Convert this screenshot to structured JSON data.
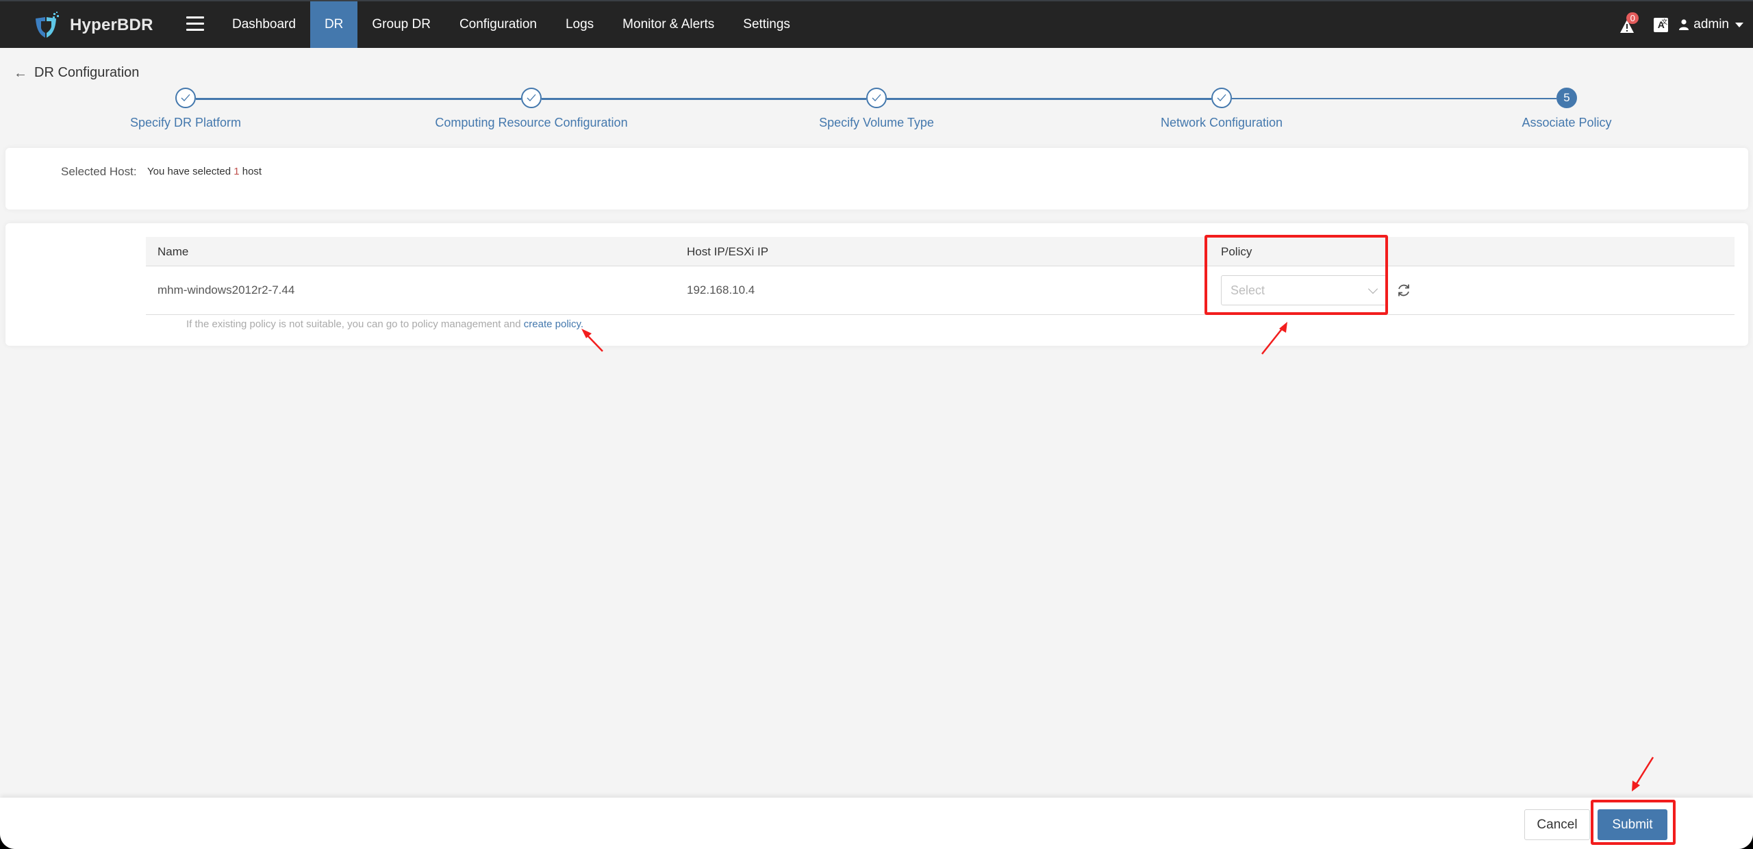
{
  "app": {
    "name": "HyperBDR",
    "nav": [
      {
        "label": "Dashboard",
        "active": false
      },
      {
        "label": "DR",
        "active": true
      },
      {
        "label": "Group DR",
        "active": false
      },
      {
        "label": "Configuration",
        "active": false
      },
      {
        "label": "Logs",
        "active": false
      },
      {
        "label": "Monitor & Alerts",
        "active": false
      },
      {
        "label": "Settings",
        "active": false
      }
    ],
    "alerts_count": "0",
    "language_icon": "A",
    "user": "admin"
  },
  "page": {
    "title": "DR Configuration",
    "steps": [
      {
        "label": "Specify DR Platform",
        "status": "done"
      },
      {
        "label": "Computing Resource Configuration",
        "status": "done"
      },
      {
        "label": "Specify Volume Type",
        "status": "done"
      },
      {
        "label": "Network Configuration",
        "status": "done"
      },
      {
        "label": "Associate Policy",
        "status": "current",
        "number": "5"
      }
    ]
  },
  "selected_host": {
    "label": "Selected Host:",
    "prefix": "You have selected ",
    "count": "1",
    "suffix": " host"
  },
  "table": {
    "columns": [
      "Name",
      "Host IP/ESXi IP",
      "Policy"
    ],
    "rows": [
      {
        "name": "mhm-windows2012r2-7.44",
        "ip": "192.168.10.4",
        "policy_placeholder": "Select"
      }
    ],
    "hint_text": "If the existing policy is not suitable, you can go to policy management and ",
    "hint_link": "create policy."
  },
  "footer": {
    "cancel_label": "Cancel",
    "submit_label": "Submit"
  },
  "colors": {
    "accent": "#4478ad",
    "topbar": "#242424",
    "annotation": "#f21d1d",
    "alert_badge": "#e35b5b"
  }
}
